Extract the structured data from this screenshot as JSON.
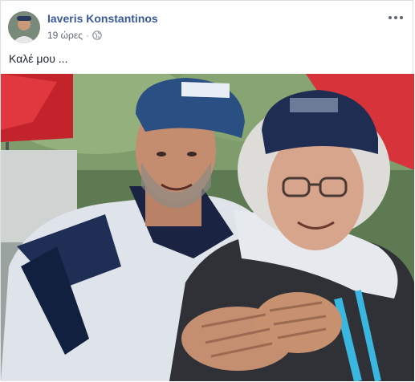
{
  "post": {
    "author_name": "Iaveris Konstantinos",
    "time": "19 ώρες",
    "privacy_icon": "globe-icon",
    "more_icon": "more-options-icon",
    "text": "Καλέ μου ...",
    "photo": {
      "description_icon": "photo-two-men-rally"
    }
  },
  "colors": {
    "author_link": "#385898",
    "meta_text": "#616770",
    "body_text": "#1d2129",
    "border": "#dddfe2"
  }
}
